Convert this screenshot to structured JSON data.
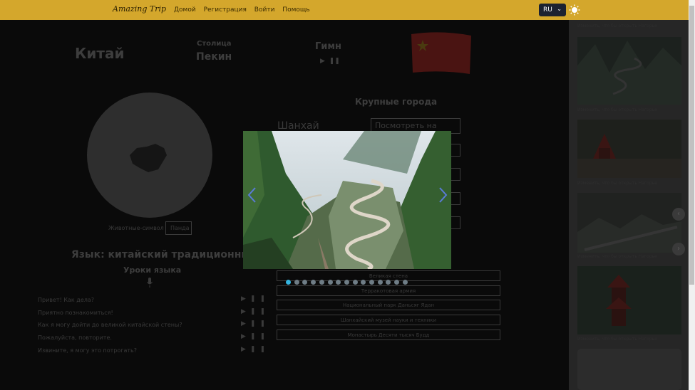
{
  "header": {
    "logo": "Amazing Trip",
    "nav": [
      "Домой",
      "Регистрация",
      "Войти",
      "Помощь"
    ],
    "language": "RU"
  },
  "country": {
    "name": "Китай",
    "capital_label": "Столица",
    "capital": "Пекин",
    "anthem_label": "Гимн",
    "cities_title": "Крупные города",
    "city_name": "Шанхай",
    "map_button": "Посмотреть на карте",
    "symbol_label": "Животные-символ",
    "symbol_button": "Панда"
  },
  "language": {
    "title": "Язык: китайский традиционный",
    "lessons_title": "Уроки языка",
    "phrases": [
      "Привет! Как дела?",
      "Приятно познакомиться!",
      "Как я могу дойти до великой китайской стены?",
      "Пожалуйста, повторите.",
      "Извините, я могу это потрогать?"
    ]
  },
  "places": [
    "Великая стена",
    "Терракотовая армия",
    "Национальный парк Даньсяг Ядан",
    "Шанхайский музей науки и техники",
    "Монастырь Десяти тысяч Будд"
  ],
  "sidebar": {
    "card_label": "Изменить, что бы открыть Нагорье"
  },
  "modal": {
    "slide_count": 15,
    "active_slide": 1
  },
  "colors": {
    "header": "#d4a72c",
    "sidebar": "#262626",
    "active_dot": "#35b5e0"
  }
}
